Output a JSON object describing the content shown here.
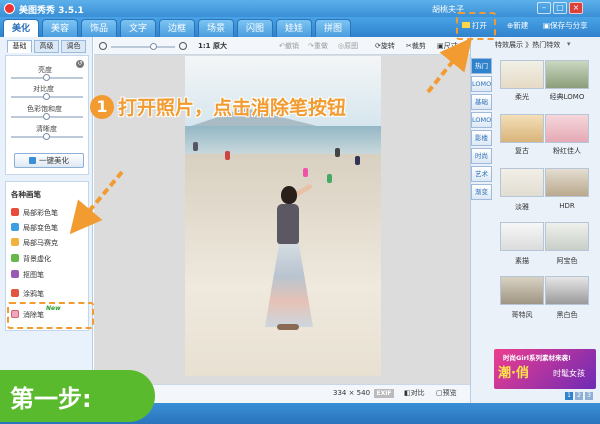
{
  "window": {
    "title": "美图秀秀 3.5.1",
    "user": "胡桃夫子",
    "minimize": "–",
    "maximize": "□",
    "close": "×"
  },
  "main_tabs": [
    "美化",
    "美容",
    "饰品",
    "文字",
    "边框",
    "场景",
    "闪图",
    "娃娃",
    "拼图"
  ],
  "top_actions": {
    "open": "打开",
    "new": "新建",
    "save_share": "保存与分享"
  },
  "left_panel": {
    "sub_tabs": [
      "基础",
      "高级",
      "调色"
    ],
    "adjustments": [
      {
        "label": "亮度",
        "value": 0.5
      },
      {
        "label": "对比度",
        "value": 0.5
      },
      {
        "label": "色彩饱和度",
        "value": 0.5
      },
      {
        "label": "清晰度",
        "value": 0.5
      }
    ],
    "one_key_button": "一键美化",
    "pens_title": "各种画笔",
    "pens": [
      "局部彩色笔",
      "局部变色笔",
      "局部马赛克",
      "背景虚化",
      "抠图笔",
      "涂鸦笔",
      "消除笔"
    ],
    "new_badge": "New",
    "pen_colors": [
      "#e74c3c",
      "#3aa0e3",
      "#f2b33d",
      "#67b84b",
      "#9b59b6",
      "#f4a1c6",
      "#f2a6c0"
    ]
  },
  "toolbar": {
    "zoom_label": "1:1 原大",
    "undo": "撤销",
    "redo": "重做",
    "original": "原图",
    "rotate": "旋转",
    "crop": "裁剪",
    "size": "尺寸"
  },
  "status_bar": {
    "dimensions": "334 × 540",
    "exif": "EXIF",
    "compare": "对比",
    "preview": "预览"
  },
  "right_panel": {
    "header": "特效展示 》热门特效",
    "side_tabs": [
      "热门",
      "LOMO",
      "基础",
      "LOMO",
      "影楼",
      "时尚",
      "艺术",
      "渐变"
    ],
    "effects": [
      "柔光",
      "经典LOMO",
      "复古",
      "粉红佳人",
      "淡雅",
      "HDR",
      "素描",
      "阿宝色",
      "哥特风",
      "黑白色"
    ],
    "ad_title": "时尚Girl系列素材来袭!",
    "ad_big": "潮·俏",
    "ad_side": "时髦女孩",
    "pages": [
      "1",
      "2",
      "3"
    ]
  },
  "annotations": {
    "step_number": "1",
    "instruction": "打开照片，点击消除笔按钮",
    "step_label": "第一步:"
  }
}
